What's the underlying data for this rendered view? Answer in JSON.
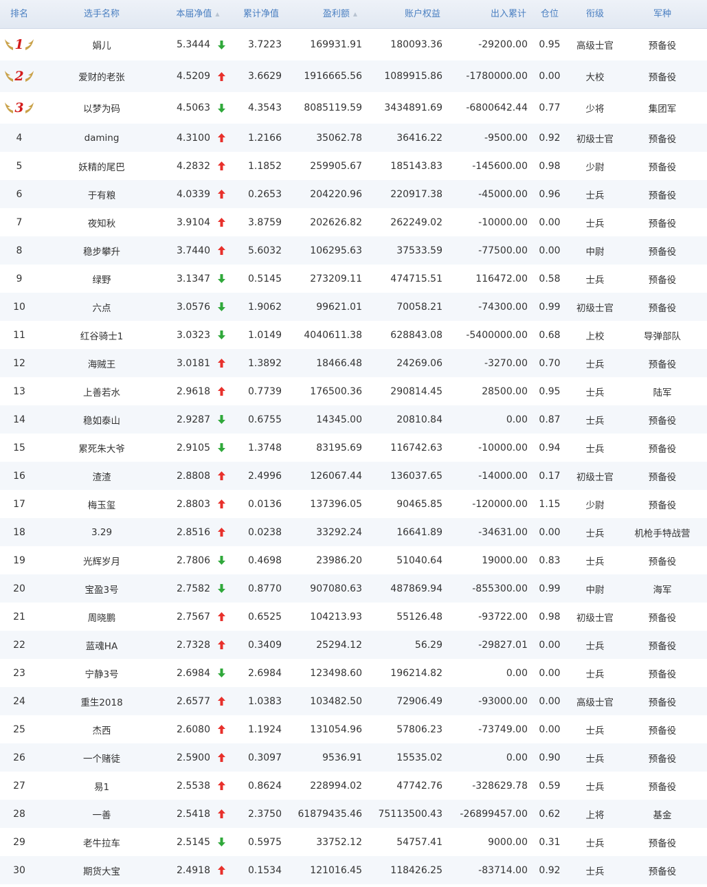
{
  "colors": {
    "header_text": "#4a7fc1",
    "up_arrow": "#e8302b",
    "down_arrow": "#2fa83a",
    "medal_digit": "#d31c1c",
    "wing": "#c9a24a"
  },
  "icons": {
    "up": "arrow-up-icon",
    "down": "arrow-down-icon",
    "medal": "medal-wings-icon",
    "sort": "sort-icon"
  },
  "header": {
    "rank": "排名",
    "name": "选手名称",
    "nav": "本届净值",
    "cumnav": "累计净值",
    "profit": "盈利额",
    "equity": "账户权益",
    "inout": "出入累计",
    "position": "仓位",
    "title": "衔级",
    "branch": "军种"
  },
  "rows": [
    {
      "rank": "1",
      "name": "娟儿",
      "nav": "5.3444",
      "trend": "down",
      "cumnav": "3.7223",
      "profit": "169931.91",
      "equity": "180093.36",
      "inout": "-29200.00",
      "position": "0.95",
      "title": "高级士官",
      "branch": "预备役"
    },
    {
      "rank": "2",
      "name": "爱财的老张",
      "nav": "4.5209",
      "trend": "up",
      "cumnav": "3.6629",
      "profit": "1916665.56",
      "equity": "1089915.86",
      "inout": "-1780000.00",
      "position": "0.00",
      "title": "大校",
      "branch": "预备役"
    },
    {
      "rank": "3",
      "name": "以梦为码",
      "nav": "4.5063",
      "trend": "down",
      "cumnav": "4.3543",
      "profit": "8085119.59",
      "equity": "3434891.69",
      "inout": "-6800642.44",
      "position": "0.77",
      "title": "少将",
      "branch": "集团军"
    },
    {
      "rank": "4",
      "name": "daming",
      "nav": "4.3100",
      "trend": "up",
      "cumnav": "1.2166",
      "profit": "35062.78",
      "equity": "36416.22",
      "inout": "-9500.00",
      "position": "0.92",
      "title": "初级士官",
      "branch": "预备役"
    },
    {
      "rank": "5",
      "name": "妖精的尾巴",
      "nav": "4.2832",
      "trend": "up",
      "cumnav": "1.1852",
      "profit": "259905.67",
      "equity": "185143.83",
      "inout": "-145600.00",
      "position": "0.98",
      "title": "少尉",
      "branch": "预备役"
    },
    {
      "rank": "6",
      "name": "于有粮",
      "nav": "4.0339",
      "trend": "up",
      "cumnav": "0.2653",
      "profit": "204220.96",
      "equity": "220917.38",
      "inout": "-45000.00",
      "position": "0.96",
      "title": "士兵",
      "branch": "预备役"
    },
    {
      "rank": "7",
      "name": "夜知秋",
      "nav": "3.9104",
      "trend": "up",
      "cumnav": "3.8759",
      "profit": "202626.82",
      "equity": "262249.02",
      "inout": "-10000.00",
      "position": "0.00",
      "title": "士兵",
      "branch": "预备役"
    },
    {
      "rank": "8",
      "name": "稳步攀升",
      "nav": "3.7440",
      "trend": "up",
      "cumnav": "5.6032",
      "profit": "106295.63",
      "equity": "37533.59",
      "inout": "-77500.00",
      "position": "0.00",
      "title": "中尉",
      "branch": "预备役"
    },
    {
      "rank": "9",
      "name": "绿野",
      "nav": "3.1347",
      "trend": "down",
      "cumnav": "0.5145",
      "profit": "273209.11",
      "equity": "474715.51",
      "inout": "116472.00",
      "position": "0.58",
      "title": "士兵",
      "branch": "预备役"
    },
    {
      "rank": "10",
      "name": "六点",
      "nav": "3.0576",
      "trend": "down",
      "cumnav": "1.9062",
      "profit": "99621.01",
      "equity": "70058.21",
      "inout": "-74300.00",
      "position": "0.99",
      "title": "初级士官",
      "branch": "预备役"
    },
    {
      "rank": "11",
      "name": "红谷骑士1",
      "nav": "3.0323",
      "trend": "down",
      "cumnav": "1.0149",
      "profit": "4040611.38",
      "equity": "628843.08",
      "inout": "-5400000.00",
      "position": "0.68",
      "title": "上校",
      "branch": "导弹部队"
    },
    {
      "rank": "12",
      "name": "海贼王",
      "nav": "3.0181",
      "trend": "up",
      "cumnav": "1.3892",
      "profit": "18466.48",
      "equity": "24269.06",
      "inout": "-3270.00",
      "position": "0.70",
      "title": "士兵",
      "branch": "预备役"
    },
    {
      "rank": "13",
      "name": "上善若水",
      "nav": "2.9618",
      "trend": "up",
      "cumnav": "0.7739",
      "profit": "176500.36",
      "equity": "290814.45",
      "inout": "28500.00",
      "position": "0.95",
      "title": "士兵",
      "branch": "陆军"
    },
    {
      "rank": "14",
      "name": "稳如泰山",
      "nav": "2.9287",
      "trend": "down",
      "cumnav": "0.6755",
      "profit": "14345.00",
      "equity": "20810.84",
      "inout": "0.00",
      "position": "0.87",
      "title": "士兵",
      "branch": "预备役"
    },
    {
      "rank": "15",
      "name": "累死朱大爷",
      "nav": "2.9105",
      "trend": "down",
      "cumnav": "1.3748",
      "profit": "83195.69",
      "equity": "116742.63",
      "inout": "-10000.00",
      "position": "0.94",
      "title": "士兵",
      "branch": "预备役"
    },
    {
      "rank": "16",
      "name": "渣渣",
      "nav": "2.8808",
      "trend": "up",
      "cumnav": "2.4996",
      "profit": "126067.44",
      "equity": "136037.65",
      "inout": "-14000.00",
      "position": "0.17",
      "title": "初级士官",
      "branch": "预备役"
    },
    {
      "rank": "17",
      "name": "梅玉玺",
      "nav": "2.8803",
      "trend": "up",
      "cumnav": "0.0136",
      "profit": "137396.05",
      "equity": "90465.85",
      "inout": "-120000.00",
      "position": "1.15",
      "title": "少尉",
      "branch": "预备役"
    },
    {
      "rank": "18",
      "name": "3.29",
      "nav": "2.8516",
      "trend": "up",
      "cumnav": "0.0238",
      "profit": "33292.24",
      "equity": "16641.89",
      "inout": "-34631.00",
      "position": "0.00",
      "title": "士兵",
      "branch": "机枪手特战营"
    },
    {
      "rank": "19",
      "name": "光辉岁月",
      "nav": "2.7806",
      "trend": "down",
      "cumnav": "0.4698",
      "profit": "23986.20",
      "equity": "51040.64",
      "inout": "19000.00",
      "position": "0.83",
      "title": "士兵",
      "branch": "预备役"
    },
    {
      "rank": "20",
      "name": "宝盈3号",
      "nav": "2.7582",
      "trend": "down",
      "cumnav": "0.8770",
      "profit": "907080.63",
      "equity": "487869.94",
      "inout": "-855300.00",
      "position": "0.99",
      "title": "中尉",
      "branch": "海军"
    },
    {
      "rank": "21",
      "name": "周晓鹏",
      "nav": "2.7567",
      "trend": "up",
      "cumnav": "0.6525",
      "profit": "104213.93",
      "equity": "55126.48",
      "inout": "-93722.00",
      "position": "0.98",
      "title": "初级士官",
      "branch": "预备役"
    },
    {
      "rank": "22",
      "name": "蓝魂HA",
      "nav": "2.7328",
      "trend": "up",
      "cumnav": "0.3409",
      "profit": "25294.12",
      "equity": "56.29",
      "inout": "-29827.01",
      "position": "0.00",
      "title": "士兵",
      "branch": "预备役"
    },
    {
      "rank": "23",
      "name": "宁静3号",
      "nav": "2.6984",
      "trend": "down",
      "cumnav": "2.6984",
      "profit": "123498.60",
      "equity": "196214.82",
      "inout": "0.00",
      "position": "0.00",
      "title": "士兵",
      "branch": "预备役"
    },
    {
      "rank": "24",
      "name": "重生2018",
      "nav": "2.6577",
      "trend": "up",
      "cumnav": "1.0383",
      "profit": "103482.50",
      "equity": "72906.49",
      "inout": "-93000.00",
      "position": "0.00",
      "title": "高级士官",
      "branch": "预备役"
    },
    {
      "rank": "25",
      "name": "杰西",
      "nav": "2.6080",
      "trend": "up",
      "cumnav": "1.1924",
      "profit": "131054.96",
      "equity": "57806.23",
      "inout": "-73749.00",
      "position": "0.00",
      "title": "士兵",
      "branch": "预备役"
    },
    {
      "rank": "26",
      "name": "一个赌徒",
      "nav": "2.5900",
      "trend": "up",
      "cumnav": "0.3097",
      "profit": "9536.91",
      "equity": "15535.02",
      "inout": "0.00",
      "position": "0.90",
      "title": "士兵",
      "branch": "预备役"
    },
    {
      "rank": "27",
      "name": "易1",
      "nav": "2.5538",
      "trend": "up",
      "cumnav": "0.8624",
      "profit": "228994.02",
      "equity": "47742.76",
      "inout": "-328629.78",
      "position": "0.59",
      "title": "士兵",
      "branch": "预备役"
    },
    {
      "rank": "28",
      "name": "一善",
      "nav": "2.5418",
      "trend": "up",
      "cumnav": "2.3750",
      "profit": "61879435.46",
      "equity": "75113500.43",
      "inout": "-26899457.00",
      "position": "0.62",
      "title": "上将",
      "branch": "基金"
    },
    {
      "rank": "29",
      "name": "老牛拉车",
      "nav": "2.5145",
      "trend": "down",
      "cumnav": "0.5975",
      "profit": "33752.12",
      "equity": "54757.41",
      "inout": "9000.00",
      "position": "0.31",
      "title": "士兵",
      "branch": "预备役"
    },
    {
      "rank": "30",
      "name": "期货大宝",
      "nav": "2.4918",
      "trend": "up",
      "cumnav": "0.1534",
      "profit": "121016.45",
      "equity": "118426.25",
      "inout": "-83714.00",
      "position": "0.92",
      "title": "士兵",
      "branch": "预备役"
    }
  ]
}
